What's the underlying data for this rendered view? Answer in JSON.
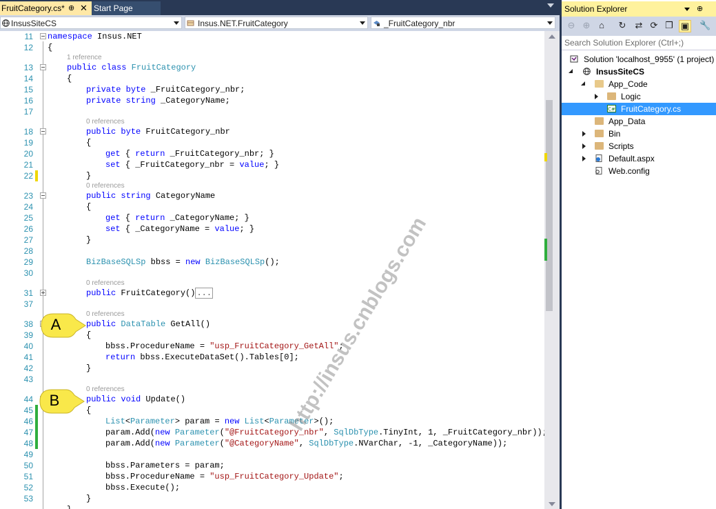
{
  "tabs": {
    "active": {
      "label": "FruitCategory.cs*",
      "pin": "⊕",
      "close": "✕"
    },
    "inactive": {
      "label": "Start Page"
    }
  },
  "navbar": {
    "project": "InsusSiteCS",
    "class": "Insus.NET.FruitCategory",
    "member": "_FruitCategory_nbr"
  },
  "editor": {
    "lines": [
      {
        "n": "11"
      },
      {
        "n": "12"
      },
      {
        "n": "13"
      },
      {
        "n": "14"
      },
      {
        "n": "15"
      },
      {
        "n": "16"
      },
      {
        "n": "17"
      },
      {
        "n": "18"
      },
      {
        "n": "19"
      },
      {
        "n": "20"
      },
      {
        "n": "21"
      },
      {
        "n": "22"
      },
      {
        "n": "23"
      },
      {
        "n": "24"
      },
      {
        "n": "25"
      },
      {
        "n": "26"
      },
      {
        "n": "27"
      },
      {
        "n": "28"
      },
      {
        "n": "29"
      },
      {
        "n": "30"
      },
      {
        "n": "31"
      },
      {
        "n": "37"
      },
      {
        "n": "38"
      },
      {
        "n": "39"
      },
      {
        "n": "40"
      },
      {
        "n": "41"
      },
      {
        "n": "42"
      },
      {
        "n": "43"
      },
      {
        "n": "44"
      },
      {
        "n": "45"
      },
      {
        "n": "46"
      },
      {
        "n": "47"
      },
      {
        "n": "48"
      },
      {
        "n": "49"
      },
      {
        "n": "50"
      },
      {
        "n": "51"
      },
      {
        "n": "52"
      },
      {
        "n": "53"
      }
    ],
    "refs": {
      "one": "1 reference",
      "zero": "0 references"
    },
    "code": {
      "l11a": "namespace",
      "l11b": " Insus.NET",
      "brace_open": "{",
      "brace_close": "}",
      "l13a": "public",
      "l13b": "class",
      "l13c": "FruitCategory",
      "private": "private",
      "byte": "byte",
      "string": "string",
      "l15c": " _FruitCategory_nbr;",
      "l16c": " _CategoryName;",
      "public": "public",
      "l18c": " FruitCategory_nbr",
      "get": "get",
      "set": "set",
      "return": "return",
      "value": "value",
      "l20": " _FruitCategory_nbr; }",
      "l21a": " { _FruitCategory_nbr = ",
      "semi_close": "; }",
      "ob": " { ",
      "l23c": " CategoryName",
      "l25": " _CategoryName; }",
      "l26a": " { _CategoryName = ",
      "bizType": "BizBaseSQLSp",
      "l29b": " bbss = ",
      "new": "new",
      "l29d": "();",
      "l31b": " FruitCategory()",
      "ellipsis": "...",
      "datatable": "DataTable",
      "l38c": " GetAll()",
      "l40a": "bbss.ProcedureName = ",
      "l40b": "\"usp_FruitCategory_GetAll\"",
      "semi": ";",
      "l41b": " bbss.ExecuteDataSet().Tables[0];",
      "void": "void",
      "l44c": " Update()",
      "list": "List",
      "lt": "<",
      "parameter": "Parameter",
      "gt": ">",
      "l46b": " param = ",
      "l46e": "();",
      "padd": "param.Add(",
      "sp": " ",
      "paren": "(",
      "l47s": "\"@FruitCategory_nbr\"",
      "sqldbtype": "SqlDbType",
      "l47t": ".TinyInt, 1, _FruitCategory_nbr));",
      "l48s": "\"@CategoryName\"",
      "l48t": ".NVarChar, -1, _CategoryName));",
      "comma": ", ",
      "l50": "bbss.Parameters = param;",
      "l51b": "\"usp_FruitCategory_Update\"",
      "l52": "bbss.Execute();"
    }
  },
  "callouts": {
    "a": "A",
    "b": "B"
  },
  "watermark": "http://insus.cnblogs.com",
  "solution_explorer": {
    "title": "Solution Explorer",
    "pin": "⊕",
    "search_placeholder": "Search Solution Explorer (Ctrl+;)",
    "nodes": {
      "solution": "Solution 'localhost_9955' (1 project)",
      "project": "InsusSiteCS",
      "app_code": "App_Code",
      "logic": "Logic",
      "fruit": "FruitCategory.cs",
      "app_data": "App_Data",
      "bin": "Bin",
      "scripts": "Scripts",
      "default": "Default.aspx",
      "webconfig": "Web.config"
    }
  },
  "colors": {
    "keyword": "#0000ff",
    "type": "#2b91af",
    "string": "#a31515",
    "callout": "#f9e84a",
    "selection": "#3399ff"
  }
}
